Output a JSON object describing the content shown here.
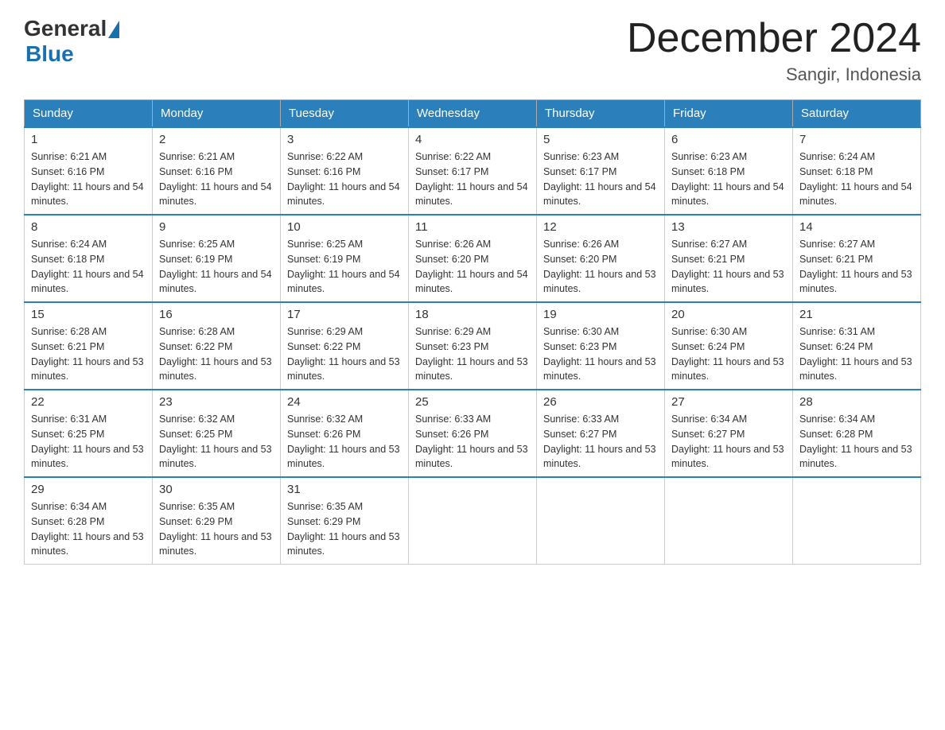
{
  "header": {
    "logo_general": "General",
    "logo_blue": "Blue",
    "month_title": "December 2024",
    "location": "Sangir, Indonesia"
  },
  "calendar": {
    "days_of_week": [
      "Sunday",
      "Monday",
      "Tuesday",
      "Wednesday",
      "Thursday",
      "Friday",
      "Saturday"
    ],
    "weeks": [
      [
        {
          "day": "1",
          "sunrise": "6:21 AM",
          "sunset": "6:16 PM",
          "daylight": "11 hours and 54 minutes."
        },
        {
          "day": "2",
          "sunrise": "6:21 AM",
          "sunset": "6:16 PM",
          "daylight": "11 hours and 54 minutes."
        },
        {
          "day": "3",
          "sunrise": "6:22 AM",
          "sunset": "6:16 PM",
          "daylight": "11 hours and 54 minutes."
        },
        {
          "day": "4",
          "sunrise": "6:22 AM",
          "sunset": "6:17 PM",
          "daylight": "11 hours and 54 minutes."
        },
        {
          "day": "5",
          "sunrise": "6:23 AM",
          "sunset": "6:17 PM",
          "daylight": "11 hours and 54 minutes."
        },
        {
          "day": "6",
          "sunrise": "6:23 AM",
          "sunset": "6:18 PM",
          "daylight": "11 hours and 54 minutes."
        },
        {
          "day": "7",
          "sunrise": "6:24 AM",
          "sunset": "6:18 PM",
          "daylight": "11 hours and 54 minutes."
        }
      ],
      [
        {
          "day": "8",
          "sunrise": "6:24 AM",
          "sunset": "6:18 PM",
          "daylight": "11 hours and 54 minutes."
        },
        {
          "day": "9",
          "sunrise": "6:25 AM",
          "sunset": "6:19 PM",
          "daylight": "11 hours and 54 minutes."
        },
        {
          "day": "10",
          "sunrise": "6:25 AM",
          "sunset": "6:19 PM",
          "daylight": "11 hours and 54 minutes."
        },
        {
          "day": "11",
          "sunrise": "6:26 AM",
          "sunset": "6:20 PM",
          "daylight": "11 hours and 54 minutes."
        },
        {
          "day": "12",
          "sunrise": "6:26 AM",
          "sunset": "6:20 PM",
          "daylight": "11 hours and 53 minutes."
        },
        {
          "day": "13",
          "sunrise": "6:27 AM",
          "sunset": "6:21 PM",
          "daylight": "11 hours and 53 minutes."
        },
        {
          "day": "14",
          "sunrise": "6:27 AM",
          "sunset": "6:21 PM",
          "daylight": "11 hours and 53 minutes."
        }
      ],
      [
        {
          "day": "15",
          "sunrise": "6:28 AM",
          "sunset": "6:21 PM",
          "daylight": "11 hours and 53 minutes."
        },
        {
          "day": "16",
          "sunrise": "6:28 AM",
          "sunset": "6:22 PM",
          "daylight": "11 hours and 53 minutes."
        },
        {
          "day": "17",
          "sunrise": "6:29 AM",
          "sunset": "6:22 PM",
          "daylight": "11 hours and 53 minutes."
        },
        {
          "day": "18",
          "sunrise": "6:29 AM",
          "sunset": "6:23 PM",
          "daylight": "11 hours and 53 minutes."
        },
        {
          "day": "19",
          "sunrise": "6:30 AM",
          "sunset": "6:23 PM",
          "daylight": "11 hours and 53 minutes."
        },
        {
          "day": "20",
          "sunrise": "6:30 AM",
          "sunset": "6:24 PM",
          "daylight": "11 hours and 53 minutes."
        },
        {
          "day": "21",
          "sunrise": "6:31 AM",
          "sunset": "6:24 PM",
          "daylight": "11 hours and 53 minutes."
        }
      ],
      [
        {
          "day": "22",
          "sunrise": "6:31 AM",
          "sunset": "6:25 PM",
          "daylight": "11 hours and 53 minutes."
        },
        {
          "day": "23",
          "sunrise": "6:32 AM",
          "sunset": "6:25 PM",
          "daylight": "11 hours and 53 minutes."
        },
        {
          "day": "24",
          "sunrise": "6:32 AM",
          "sunset": "6:26 PM",
          "daylight": "11 hours and 53 minutes."
        },
        {
          "day": "25",
          "sunrise": "6:33 AM",
          "sunset": "6:26 PM",
          "daylight": "11 hours and 53 minutes."
        },
        {
          "day": "26",
          "sunrise": "6:33 AM",
          "sunset": "6:27 PM",
          "daylight": "11 hours and 53 minutes."
        },
        {
          "day": "27",
          "sunrise": "6:34 AM",
          "sunset": "6:27 PM",
          "daylight": "11 hours and 53 minutes."
        },
        {
          "day": "28",
          "sunrise": "6:34 AM",
          "sunset": "6:28 PM",
          "daylight": "11 hours and 53 minutes."
        }
      ],
      [
        {
          "day": "29",
          "sunrise": "6:34 AM",
          "sunset": "6:28 PM",
          "daylight": "11 hours and 53 minutes."
        },
        {
          "day": "30",
          "sunrise": "6:35 AM",
          "sunset": "6:29 PM",
          "daylight": "11 hours and 53 minutes."
        },
        {
          "day": "31",
          "sunrise": "6:35 AM",
          "sunset": "6:29 PM",
          "daylight": "11 hours and 53 minutes."
        },
        null,
        null,
        null,
        null
      ]
    ]
  },
  "labels": {
    "sunrise_prefix": "Sunrise: ",
    "sunset_prefix": "Sunset: ",
    "daylight_prefix": "Daylight: "
  }
}
